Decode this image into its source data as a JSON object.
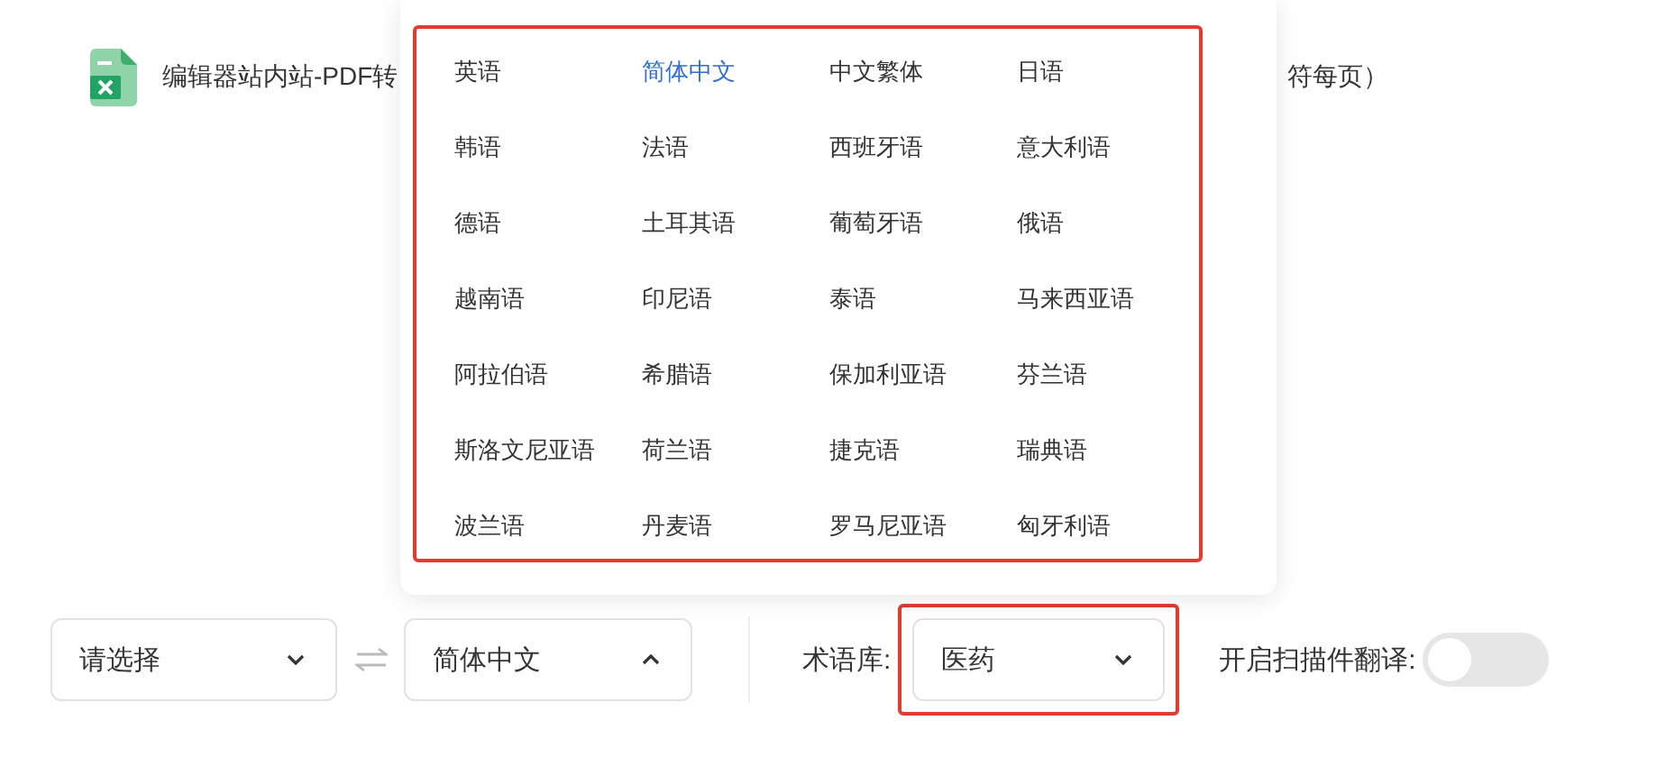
{
  "file": {
    "name": "编辑器站内站-PDF转",
    "note": "符每页）"
  },
  "language_menu": {
    "highlighted": true,
    "options": [
      {
        "label": "英语",
        "selected": false
      },
      {
        "label": "简体中文",
        "selected": true
      },
      {
        "label": "中文繁体",
        "selected": false
      },
      {
        "label": "日语",
        "selected": false
      },
      {
        "label": "韩语",
        "selected": false
      },
      {
        "label": "法语",
        "selected": false
      },
      {
        "label": "西班牙语",
        "selected": false
      },
      {
        "label": "意大利语",
        "selected": false
      },
      {
        "label": "德语",
        "selected": false
      },
      {
        "label": "土耳其语",
        "selected": false
      },
      {
        "label": "葡萄牙语",
        "selected": false
      },
      {
        "label": "俄语",
        "selected": false
      },
      {
        "label": "越南语",
        "selected": false
      },
      {
        "label": "印尼语",
        "selected": false
      },
      {
        "label": "泰语",
        "selected": false
      },
      {
        "label": "马来西亚语",
        "selected": false
      },
      {
        "label": "阿拉伯语",
        "selected": false
      },
      {
        "label": "希腊语",
        "selected": false
      },
      {
        "label": "保加利亚语",
        "selected": false
      },
      {
        "label": "芬兰语",
        "selected": false
      },
      {
        "label": "斯洛文尼亚语",
        "selected": false
      },
      {
        "label": "荷兰语",
        "selected": false
      },
      {
        "label": "捷克语",
        "selected": false
      },
      {
        "label": "瑞典语",
        "selected": false
      },
      {
        "label": "波兰语",
        "selected": false
      },
      {
        "label": "丹麦语",
        "selected": false
      },
      {
        "label": "罗马尼亚语",
        "selected": false
      },
      {
        "label": "匈牙利语",
        "selected": false
      }
    ]
  },
  "source_language": {
    "value": "请选择",
    "expanded": false
  },
  "target_language": {
    "value": "简体中文",
    "expanded": true
  },
  "glossary": {
    "label": "术语库:",
    "value": "医药",
    "expanded": false,
    "highlighted": true
  },
  "scan_translation": {
    "label": "开启扫描件翻译:",
    "on": false
  }
}
